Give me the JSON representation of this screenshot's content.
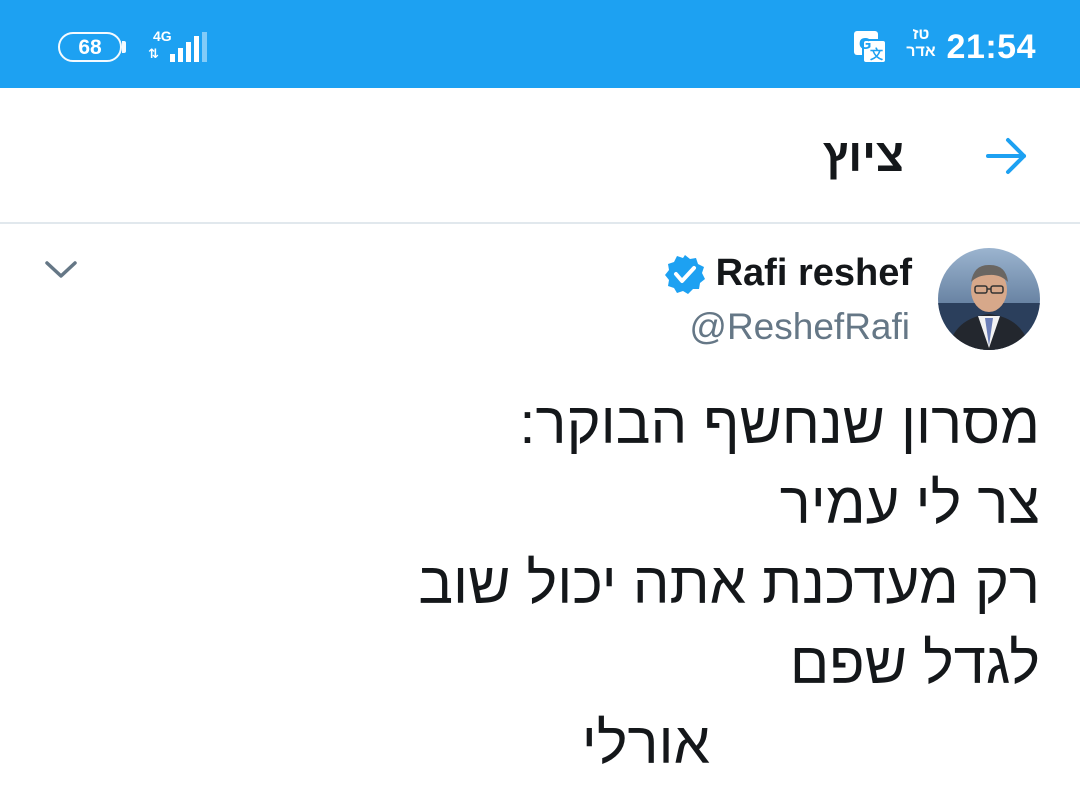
{
  "status_bar": {
    "battery_level": "68",
    "network_type": "4G",
    "data_arrows": "⇅",
    "hebrew_date": [
      "טז",
      "אדר"
    ],
    "time": "21:54",
    "color": "#1da1f2",
    "icons": [
      "battery-icon",
      "signal-icon",
      "translate-icon"
    ]
  },
  "header": {
    "title": "ציוץ",
    "back_icon": "arrow-right-icon"
  },
  "tweet": {
    "author_name": "Rafi reshef",
    "handle": "@ReshefRafi",
    "verified": true,
    "lines": [
      "מסרון שנחשף הבוקר:",
      "צר לי עמיר",
      "רק מעדכנת אתה יכול שוב",
      "לגדל שפם",
      "אורלי"
    ],
    "menu_icon": "chevron-down-icon"
  },
  "colors": {
    "accent": "#1da1f2",
    "text": "#14171a",
    "secondary": "#657786",
    "divider": "#e1e8ed"
  }
}
